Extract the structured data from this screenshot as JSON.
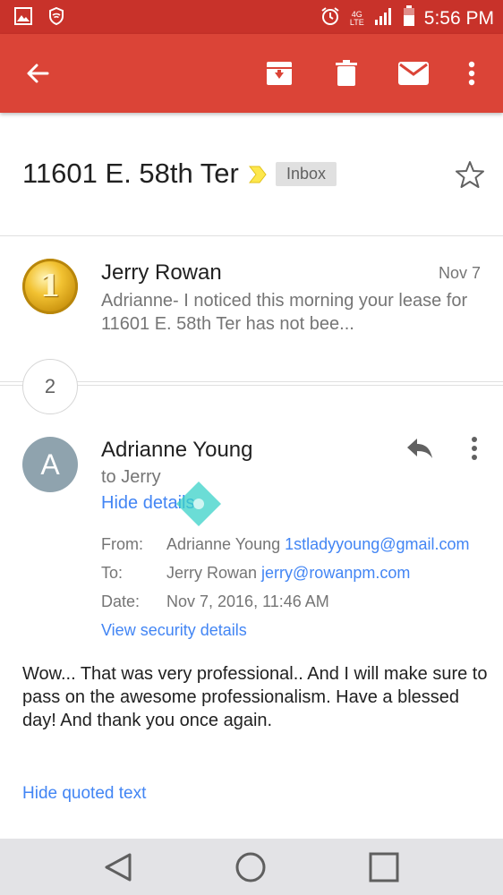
{
  "status_bar": {
    "time": "5:56 PM",
    "network": "4G LTE",
    "icons": [
      "image-icon",
      "shield-icon",
      "alarm-icon",
      "signal-icon",
      "battery-icon"
    ]
  },
  "app_bar": {
    "icons": [
      "back-arrow-icon",
      "archive-icon",
      "delete-icon",
      "mail-icon",
      "more-vert-icon"
    ],
    "color": "#db4437"
  },
  "thread": {
    "subject": "11601 E. 58th Ter",
    "label": "Inbox"
  },
  "message_1": {
    "sender": "Jerry Rowan",
    "date": "Nov 7",
    "snippet": "Adrianne- I noticed this morning your lease for 11601 E. 58th Ter has not bee...",
    "avatar_text": "1"
  },
  "collapsed_count": "2",
  "message_2": {
    "avatar_letter": "A",
    "sender": "Adrianne Young",
    "to_line": "to Jerry",
    "hide_details": "Hide details",
    "details": {
      "from_label": "From:",
      "from_name": "Adrianne Young",
      "from_email": "1stladyyoung@gmail.com",
      "to_label": "To:",
      "to_name": "Jerry Rowan",
      "to_email": "jerry@rowanpm.com",
      "date_label": "Date:",
      "date_value": "Nov 7, 2016, 11:46 AM"
    },
    "security_link": "View security details",
    "body": "Wow... That was very professional.. And I will make sure to pass on the awesome professionalism. Have a blessed day! And thank you once again.",
    "quoted_link": "Hide quoted text"
  },
  "colors": {
    "accent": "#db4437",
    "status_bar": "#c8322a",
    "link": "#4285f4",
    "avatar": "#8fa3ae"
  }
}
